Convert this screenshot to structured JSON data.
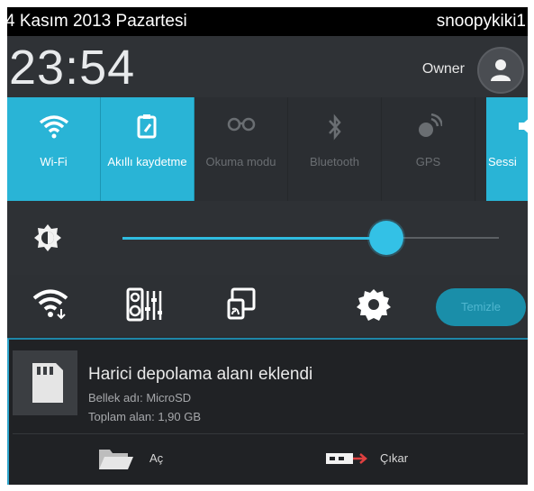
{
  "status_bar": {
    "date": "4 Kasım 2013 Pazartesi",
    "username": "snoopykiki1"
  },
  "header": {
    "time": "23:54",
    "owner_label": "Owner",
    "avatar_icon": "person-icon"
  },
  "quick_tiles": [
    {
      "label": "Wi-Fi",
      "icon": "wifi-icon",
      "active": true
    },
    {
      "label": "Akıllı kaydetme",
      "icon": "smart-save-icon",
      "active": true
    },
    {
      "label": "Okuma modu",
      "icon": "glasses-icon",
      "active": false
    },
    {
      "label": "Bluetooth",
      "icon": "bluetooth-icon",
      "active": false
    },
    {
      "label": "GPS",
      "icon": "gps-icon",
      "active": false
    },
    {
      "label": "Sessi",
      "icon": "speaker-icon",
      "active": true
    }
  ],
  "brightness": {
    "icon": "brightness-icon",
    "level": 0.7
  },
  "toggles": {
    "icons": [
      "wifi-settings-icon",
      "equalizer-icon",
      "screen-cast-icon",
      "settings-gear-icon"
    ],
    "terminal_label": "Temizle"
  },
  "notification": {
    "icon": "sd-card-icon",
    "title": "Harici depolama alanı eklendi",
    "line1": "Bellek adı: MicroSD",
    "line2": "Toplam alan: 1,90 GB",
    "actions": [
      {
        "label": "Aç",
        "icon": "folder-icon"
      },
      {
        "label": "Çıkar",
        "icon": "eject-icon"
      }
    ]
  },
  "colors": {
    "accent": "#29b4d6",
    "background": "#2a2d31",
    "statusbar": "#000000"
  }
}
